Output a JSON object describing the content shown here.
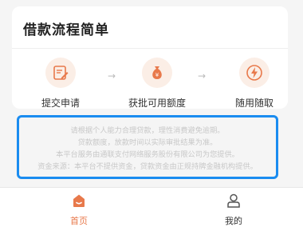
{
  "card": {
    "title": "借款流程简单",
    "steps": [
      {
        "label": "提交申请",
        "icon": "form-edit-icon"
      },
      {
        "label": "获批可用额度",
        "icon": "money-bag-icon"
      },
      {
        "label": "随用随取",
        "icon": "lightning-icon"
      }
    ],
    "arrow": "→"
  },
  "notice": {
    "lines": [
      "请根据个人能力合理贷款，理性消费避免逾期。",
      "贷款额度，放款时间以实际审批结果为准。",
      "本平台服务由通联支付网络服务股份有限公司为您提供。",
      "资金来源：本平台不提供资金，贷款资金由正规持牌金融机构提供。"
    ]
  },
  "tabbar": {
    "home_label": "首页",
    "mine_label": "我的"
  },
  "colors": {
    "accent": "#e8794b",
    "highlight_border": "#1a8cf0",
    "icon_bg": "#fbeee6"
  }
}
